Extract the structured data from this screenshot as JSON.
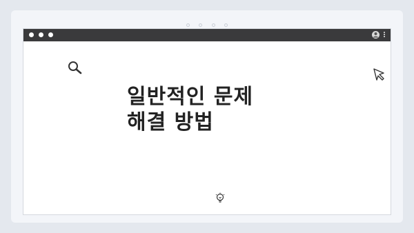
{
  "window": {
    "controls": [
      "dot",
      "dot",
      "dot"
    ],
    "profile_icon": "user-circle-icon",
    "menu_icon": "kebab-menu-icon"
  },
  "content": {
    "title_line1": "일반적인 문제",
    "title_line2": "해결 방법"
  },
  "icons": {
    "search": "magnifier-icon",
    "cursor": "mouse-pointer-icon",
    "idea": "lightbulb-icon"
  },
  "colors": {
    "background": "#e4e8ee",
    "card": "#f3f5f9",
    "titlebar": "#3a3a3c",
    "page": "#ffffff",
    "text": "#222222"
  }
}
